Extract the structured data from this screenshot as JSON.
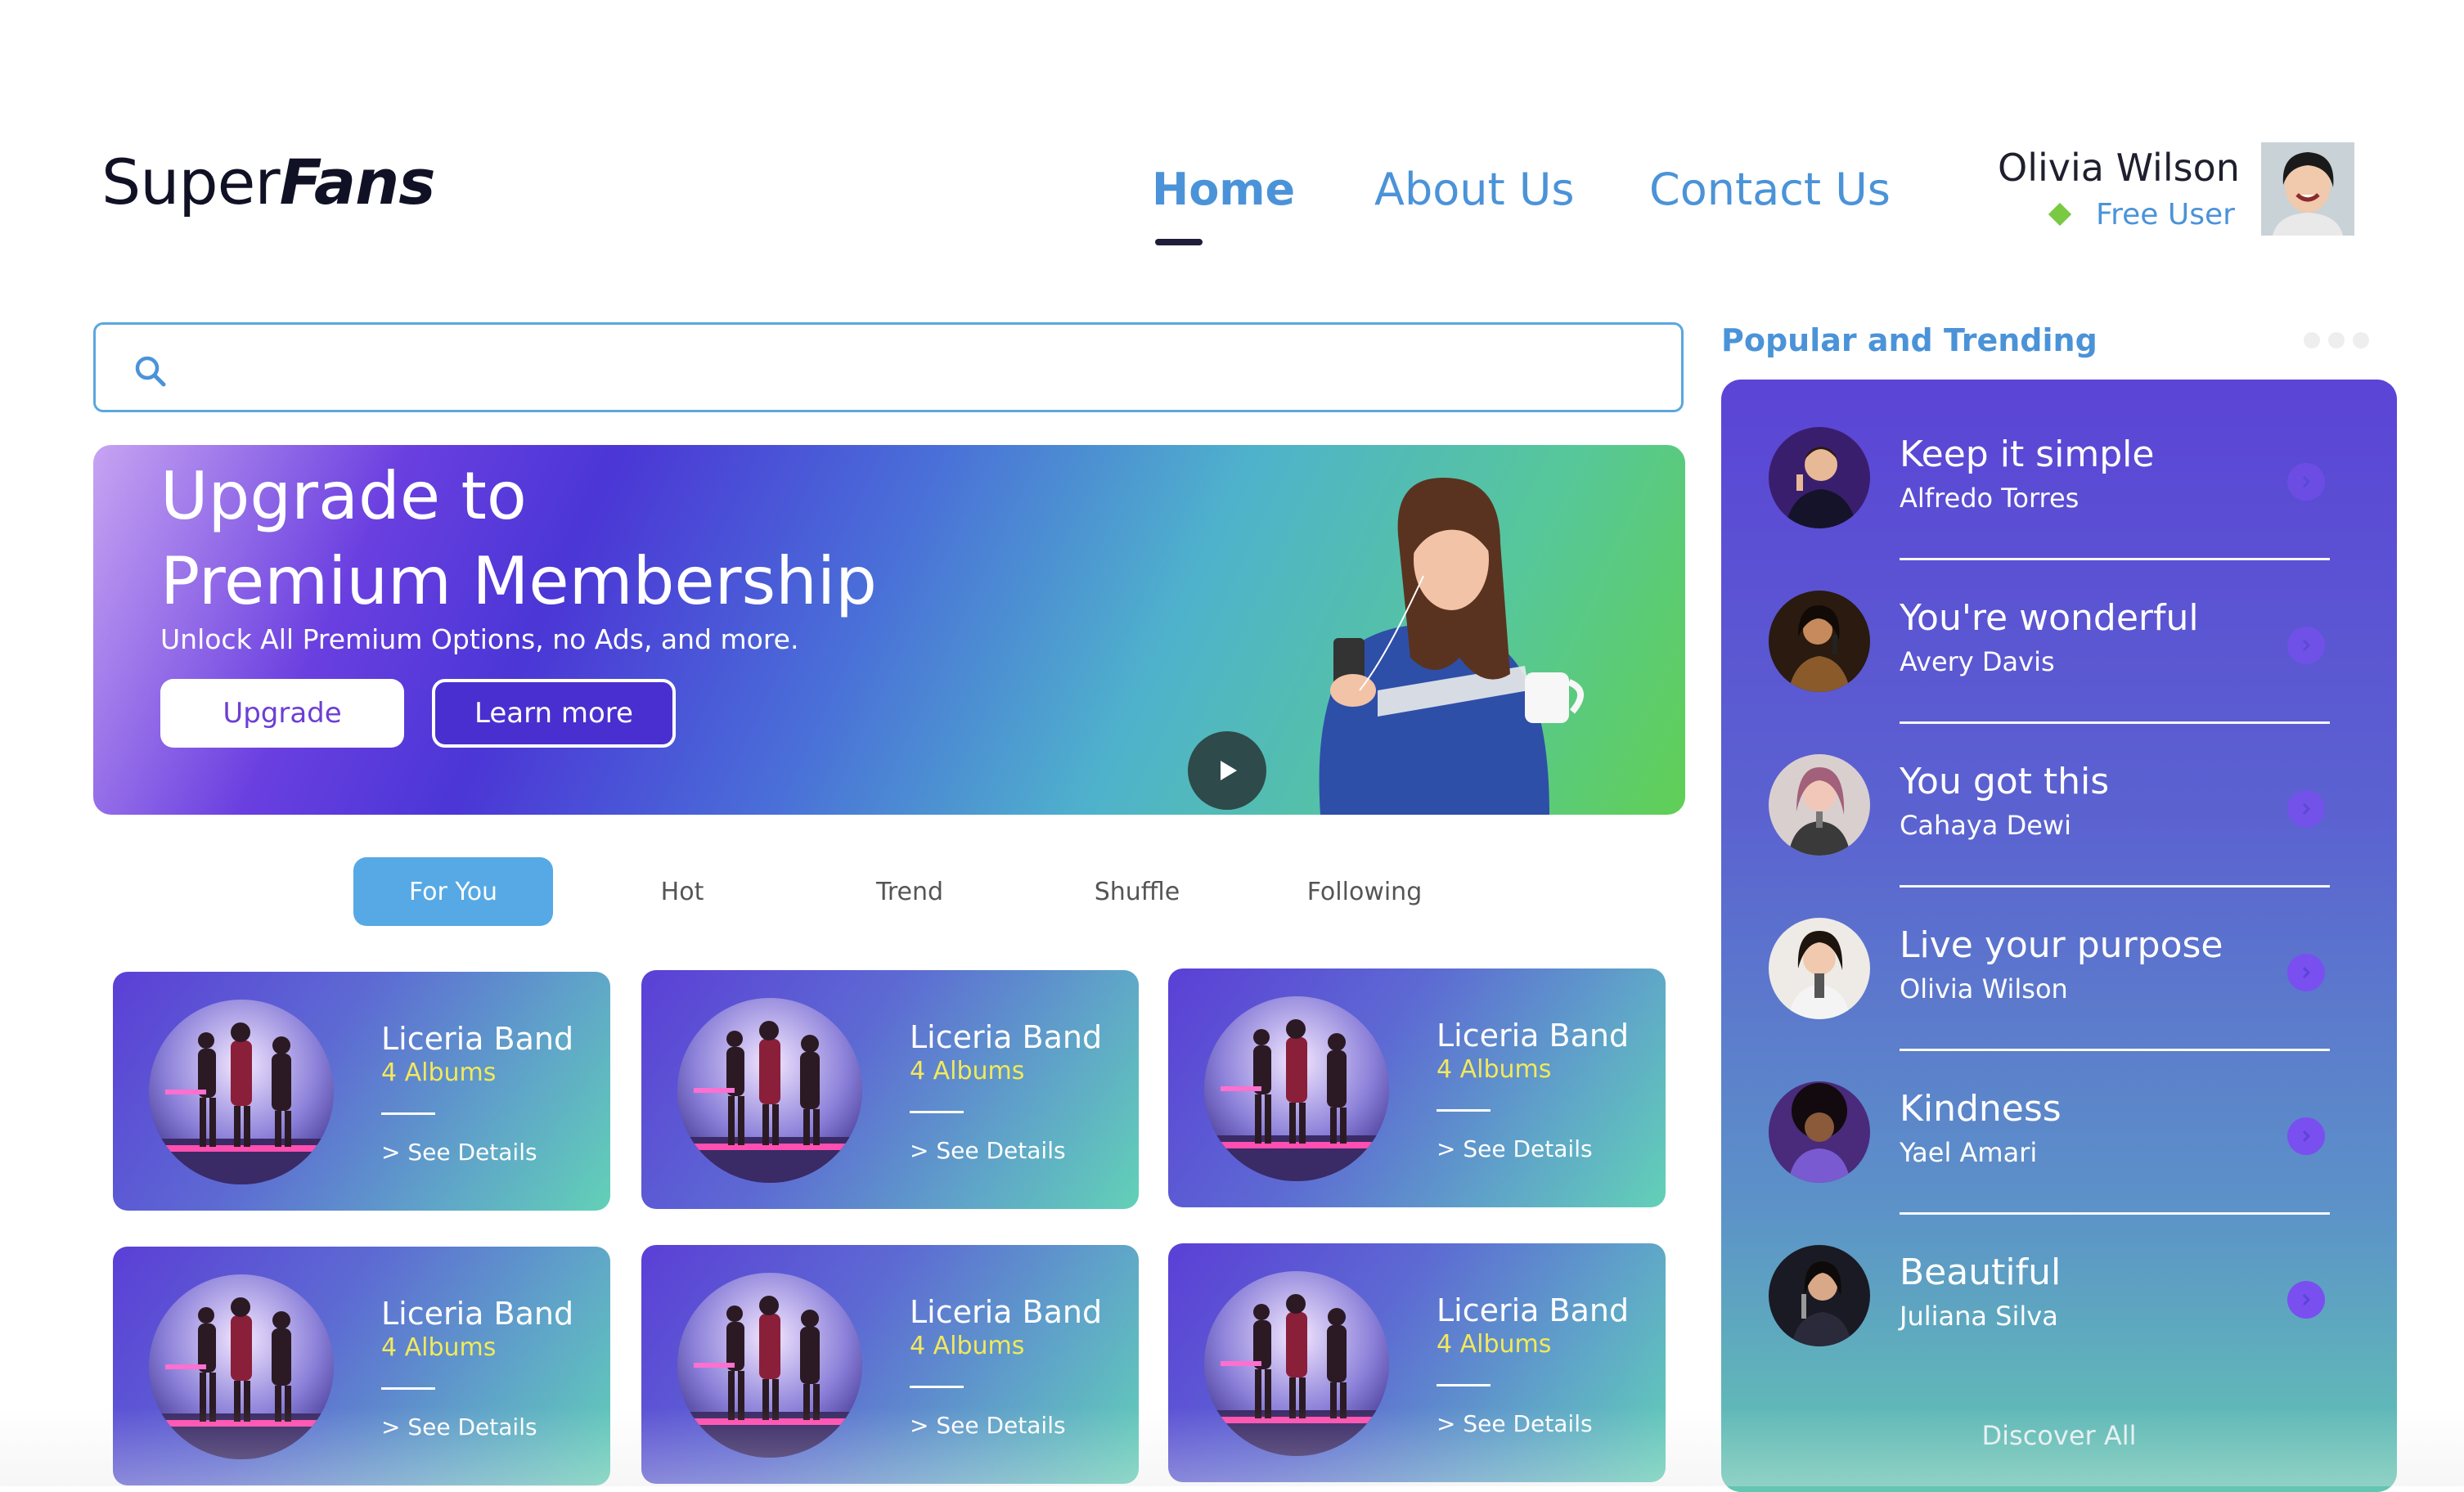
{
  "brand": {
    "logo_regular": "Super",
    "logo_bold": "Fans"
  },
  "nav": {
    "items": [
      {
        "label": "Home",
        "active": true
      },
      {
        "label": "About Us"
      },
      {
        "label": "Contact Us"
      }
    ]
  },
  "user": {
    "name": "Olivia Wilson",
    "status": "Free User",
    "status_color": "#7ac943"
  },
  "search": {
    "placeholder": ""
  },
  "banner": {
    "title_line1": "Upgrade to",
    "title_line2": "Premium Membership",
    "subtitle": "Unlock All Premium Options, no Ads, and more.",
    "upgrade_label": "Upgrade",
    "learn_more_label": "Learn more"
  },
  "tabs": [
    {
      "label": "For You",
      "active": true
    },
    {
      "label": "Hot"
    },
    {
      "label": "Trend"
    },
    {
      "label": "Shuffle"
    },
    {
      "label": "Following"
    }
  ],
  "cards": [
    {
      "title": "Liceria Band",
      "albums": "4 Albums",
      "link": "> See Details"
    },
    {
      "title": "Liceria Band",
      "albums": "4 Albums",
      "link": "> See Details"
    },
    {
      "title": "Liceria Band",
      "albums": "4 Albums",
      "link": "> See Details"
    },
    {
      "title": "Liceria Band",
      "albums": "4 Albums",
      "link": "> See Details"
    },
    {
      "title": "Liceria Band",
      "albums": "4 Albums",
      "link": "> See Details"
    },
    {
      "title": "Liceria Band",
      "albums": "4 Albums",
      "link": "> See Details"
    }
  ],
  "sidebar": {
    "heading": "Popular and Trending",
    "items": [
      {
        "title": "Keep it simple",
        "artist": "Alfredo Torres"
      },
      {
        "title": "You're wonderful",
        "artist": "Avery Davis"
      },
      {
        "title": "You got this",
        "artist": "Cahaya Dewi"
      },
      {
        "title": "Live your purpose",
        "artist": "Olivia Wilson"
      },
      {
        "title": "Kindness",
        "artist": "Yael Amari"
      },
      {
        "title": "Beautiful",
        "artist": "Juliana Silva"
      }
    ],
    "discover_label": "Discover All"
  },
  "colors": {
    "accent_blue": "#4b93d8",
    "albums_yellow": "#f2e95b",
    "button_purple": "#7a4ff0",
    "tab_active": "#56a9e4"
  }
}
